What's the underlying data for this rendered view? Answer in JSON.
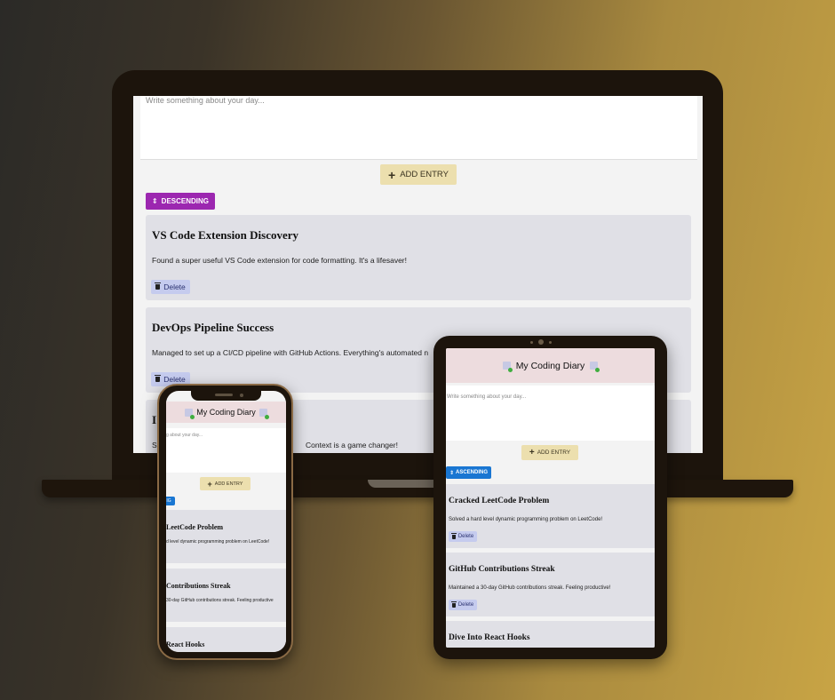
{
  "app": {
    "title": "My Coding Diary"
  },
  "editor": {
    "placeholder": "Write something about your day...",
    "phone_placeholder_fragment": "g about your day..."
  },
  "buttons": {
    "add_entry": "ADD ENTRY",
    "add_icon": "+",
    "delete": "Delete",
    "sort_descending": "DESCENDING",
    "sort_ascending": "ASCENDING",
    "sort_phone_fragment": "IG",
    "sort_icon": "⇕"
  },
  "icons": {
    "plus": "plus-icon",
    "trash": "trash-icon",
    "sort": "sort-icon",
    "logo": "diary-logo-icon"
  },
  "colors": {
    "add_button": "#ecdfae",
    "descending_button": "#9c27b0",
    "ascending_button": "#1976d2",
    "delete_button": "#c5cbee",
    "card": "#e0e0e6",
    "header": "#eddcde"
  },
  "laptop": {
    "entries": [
      {
        "title": "VS Code Extension Discovery",
        "body": "Found a super useful VS Code extension for code formatting. It's a lifesaver!"
      },
      {
        "title": "DevOps Pipeline Success",
        "body": "Managed to set up a CI/CD pipeline with GitHub Actions. Everything's automated n"
      },
      {
        "title": "I",
        "body": "S",
        "body_tail": "Context is a game changer!"
      }
    ]
  },
  "tablet": {
    "entries": [
      {
        "title": "Cracked LeetCode Problem",
        "body": "Solved a hard level dynamic programming problem on LeetCode!"
      },
      {
        "title": "GitHub Contributions Streak",
        "body": "Maintained a 30-day GitHub contributions streak. Feeling productive!"
      },
      {
        "title": "Dive Into React Hooks",
        "body": ""
      }
    ]
  },
  "phone": {
    "entries": [
      {
        "title": "LeetCode Problem",
        "body": "d level dynamic programming problem on LeetCode!"
      },
      {
        "title": "Contributions Streak",
        "body": "30-day GitHub contributions streak. Feeling productive"
      },
      {
        "title": "React Hooks",
        "body": ""
      }
    ]
  }
}
